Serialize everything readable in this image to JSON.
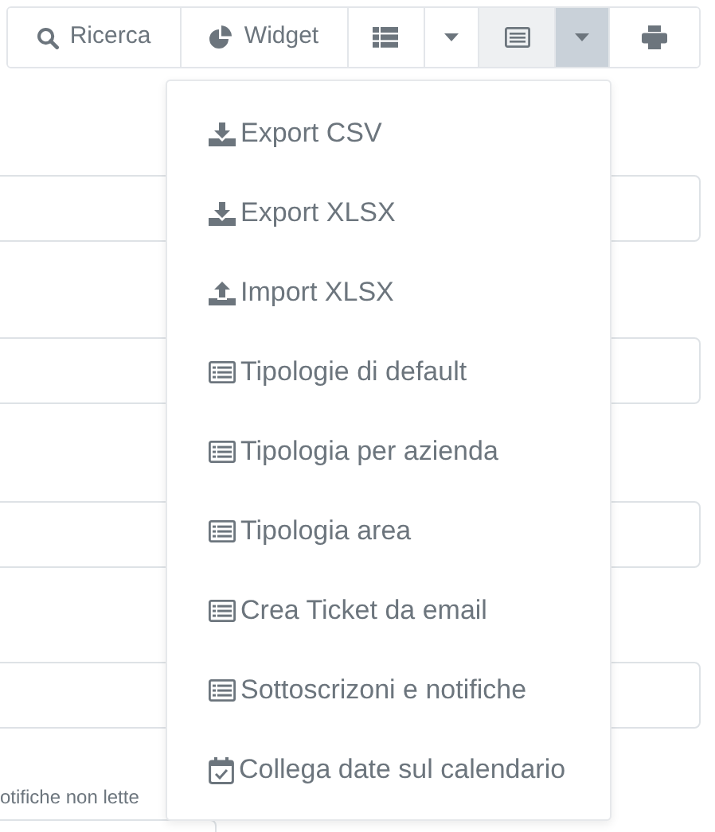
{
  "toolbar": [
    {
      "kind": "search",
      "label": "Ricerca",
      "pressed": false,
      "expanded": false
    },
    {
      "kind": "widget",
      "label": "Widget",
      "pressed": false,
      "expanded": false
    },
    {
      "kind": "list",
      "pressed": false,
      "expanded": false
    },
    {
      "kind": "caret",
      "pressed": false,
      "expanded": false
    },
    {
      "kind": "card",
      "pressed": true,
      "expanded": false
    },
    {
      "kind": "caret",
      "pressed": false,
      "expanded": true
    },
    {
      "kind": "print",
      "pressed": false,
      "expanded": false
    }
  ],
  "form": {
    "fields": [
      {
        "kind": "input"
      },
      {
        "kind": "input"
      },
      {
        "kind": "input"
      },
      {
        "kind": "input"
      }
    ],
    "checkbox_label": "otifiche non lette"
  },
  "menu": {
    "items": [
      {
        "kind": "export",
        "label": "Export CSV"
      },
      {
        "kind": "export",
        "label": "Export XLSX"
      },
      {
        "kind": "import",
        "label": "Import XLSX"
      },
      {
        "kind": "table",
        "label": "Tipologie di default"
      },
      {
        "kind": "table",
        "label": "Tipologia per azienda"
      },
      {
        "kind": "table",
        "label": "Tipologia area"
      },
      {
        "kind": "table",
        "label": "Crea Ticket da email"
      },
      {
        "kind": "table",
        "label": "Sottoscrizoni e notifiche"
      },
      {
        "kind": "calendar",
        "label": "Collega date sul calendario"
      }
    ]
  }
}
